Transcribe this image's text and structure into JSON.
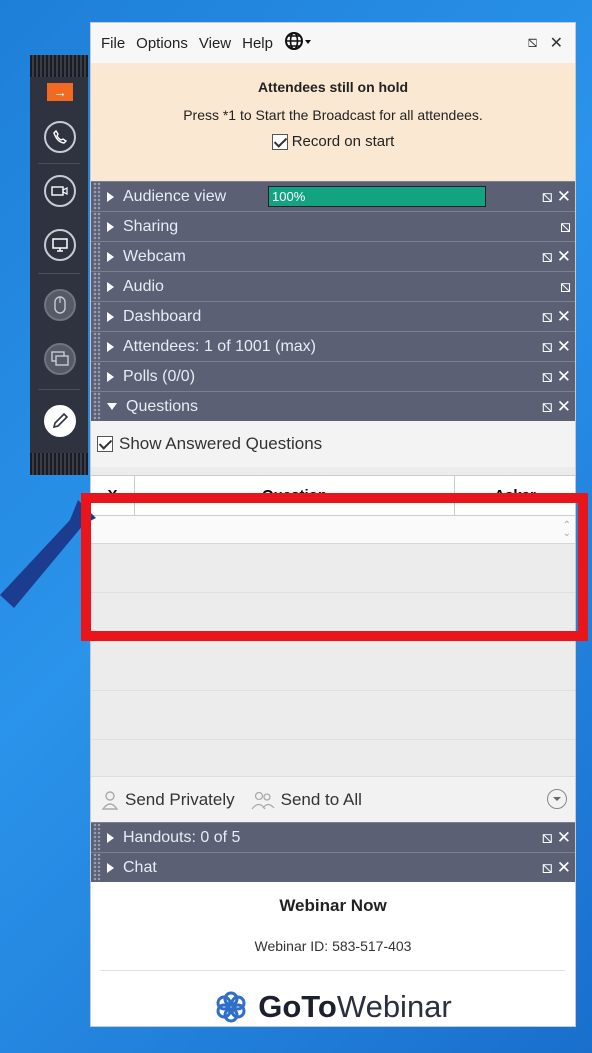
{
  "menu": {
    "file": "File",
    "options": "Options",
    "view": "View",
    "help": "Help"
  },
  "hold": {
    "title": "Attendees still on hold",
    "desc": "Press *1 to Start the Broadcast for all attendees.",
    "record": "Record on start"
  },
  "sections": {
    "audience": "Audience view",
    "audience_level": "100%",
    "sharing": "Sharing",
    "webcam": "Webcam",
    "audio": "Audio",
    "dashboard": "Dashboard",
    "attendees": "Attendees: 1 of 1001 (max)",
    "polls": "Polls (0/0)",
    "questions": "Questions",
    "handouts": "Handouts: 0 of 5",
    "chat": "Chat"
  },
  "questions": {
    "show_answered": "Show Answered Questions",
    "col_x": "X",
    "col_question": "Question",
    "col_asker": "Asker"
  },
  "send": {
    "private": "Send Privately",
    "all": "Send to All"
  },
  "brand": {
    "webinar_name": "Webinar Now",
    "webinar_id": "Webinar ID: 583-517-403",
    "logo_goto": "GoTo",
    "logo_webinar": "Webinar"
  },
  "colors": {
    "accent": "#f26a21",
    "section_bg": "#5b6075",
    "progress": "#14a380",
    "hold_bg": "#fae8d2",
    "highlight": "#e8151b"
  }
}
